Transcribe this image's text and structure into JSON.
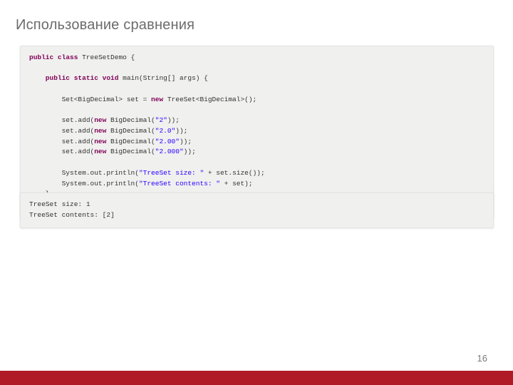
{
  "title": "Использование сравнения",
  "pageNumber": "16",
  "code": {
    "l1a": "public",
    "l1b": " class",
    "l1c": " TreeSetDemo {",
    "l2a": "    public",
    "l2b": " static",
    "l2c": " void",
    "l2d": " main(String[] args) {",
    "l3a": "        Set<BigDecimal> set = ",
    "l3b": "new",
    "l3c": " TreeSet<BigDecimal>();",
    "l4a": "        set.add(",
    "l4b": "new",
    "l4c": " BigDecimal(",
    "l4d": "\"2\"",
    "l4e": "));",
    "l5a": "        set.add(",
    "l5b": "new",
    "l5c": " BigDecimal(",
    "l5d": "\"2.0\"",
    "l5e": "));",
    "l6a": "        set.add(",
    "l6b": "new",
    "l6c": " BigDecimal(",
    "l6d": "\"2.00\"",
    "l6e": "));",
    "l7a": "        set.add(",
    "l7b": "new",
    "l7c": " BigDecimal(",
    "l7d": "\"2.000\"",
    "l7e": "));",
    "l8a": "        System.out.println(",
    "l8b": "\"TreeSet size: \"",
    "l8c": " + set.size());",
    "l9a": "        System.out.println(",
    "l9b": "\"TreeSet contents: \"",
    "l9c": " + set);",
    "l10": "    }",
    "l11": "}"
  },
  "output": {
    "l1": "TreeSet size: 1",
    "l2": "TreeSet contents: [2]"
  }
}
